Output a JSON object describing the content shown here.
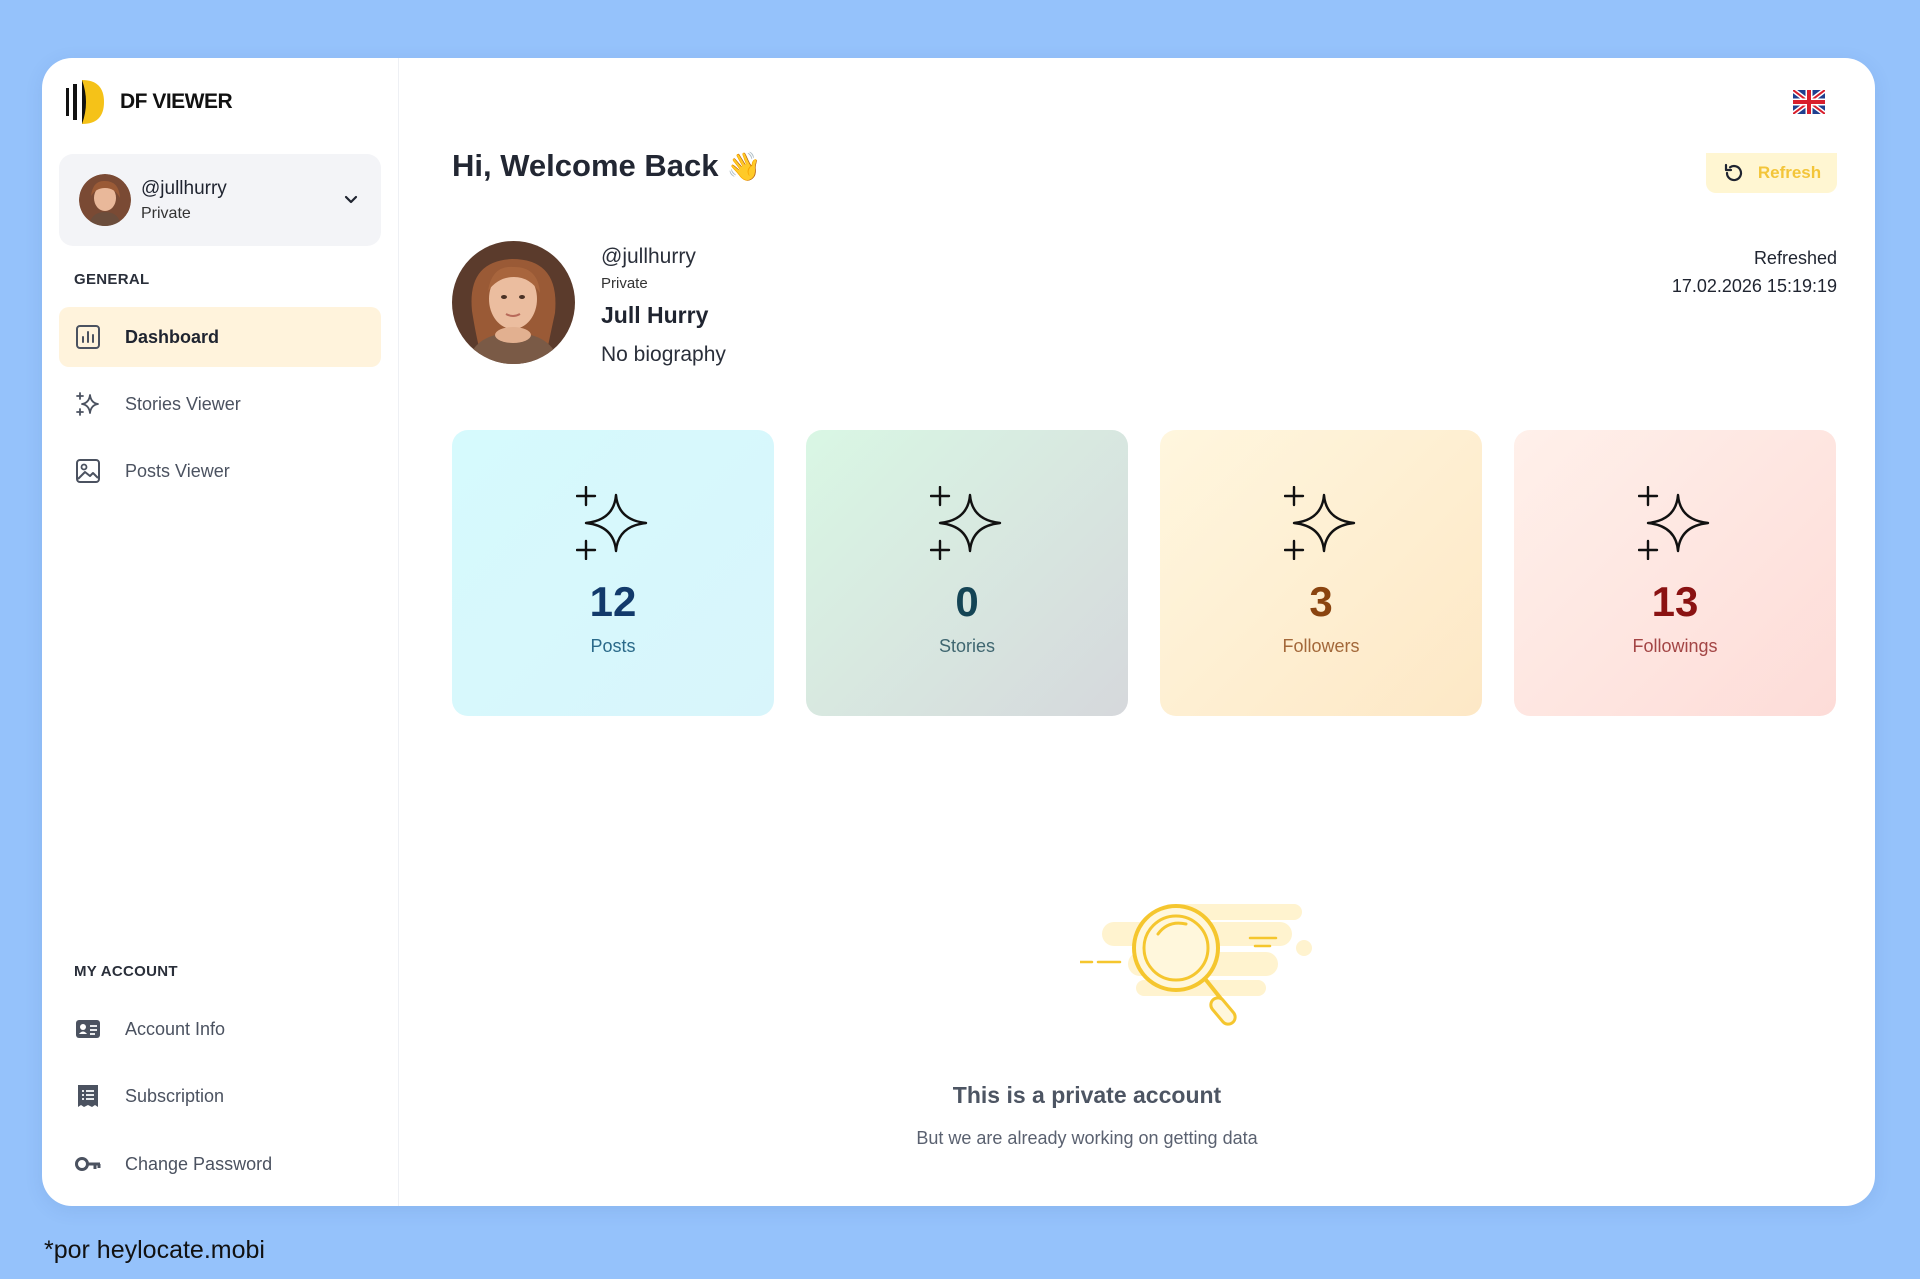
{
  "app": {
    "logo_text": "DF VIEWER"
  },
  "account": {
    "username": "@jullhurry",
    "status": "Private"
  },
  "sidebar": {
    "general_label": "GENERAL",
    "general_items": [
      {
        "label": "Dashboard",
        "icon": "chart-icon",
        "active": true
      },
      {
        "label": "Stories Viewer",
        "icon": "sparkle-icon",
        "active": false
      },
      {
        "label": "Posts Viewer",
        "icon": "image-icon",
        "active": false
      }
    ],
    "account_label": "MY ACCOUNT",
    "account_items": [
      {
        "label": "Account Info",
        "icon": "id-card-icon"
      },
      {
        "label": "Subscription",
        "icon": "receipt-icon"
      },
      {
        "label": "Change Password",
        "icon": "key-icon"
      }
    ]
  },
  "header": {
    "greeting": "Hi, Welcome Back",
    "greeting_emoji": "👋",
    "refresh_label": "Refresh",
    "language_icon": "uk-flag-icon"
  },
  "profile": {
    "username": "@jullhurry",
    "status": "Private",
    "full_name": "Jull Hurry",
    "bio": "No biography",
    "refreshed_label": "Refreshed",
    "refreshed_at": "17.02.2026 15:19:19"
  },
  "stats": [
    {
      "value": "12",
      "label": "Posts"
    },
    {
      "value": "0",
      "label": "Stories"
    },
    {
      "value": "3",
      "label": "Followers"
    },
    {
      "value": "13",
      "label": "Followings"
    }
  ],
  "empty_state": {
    "title": "This is a private account",
    "subtitle": "But we are already working on getting data"
  },
  "footnote": "*por heylocate.mobi",
  "colors": {
    "background": "#95c2fb",
    "accent": "#f3c53a",
    "active_nav": "#fff3dc"
  }
}
